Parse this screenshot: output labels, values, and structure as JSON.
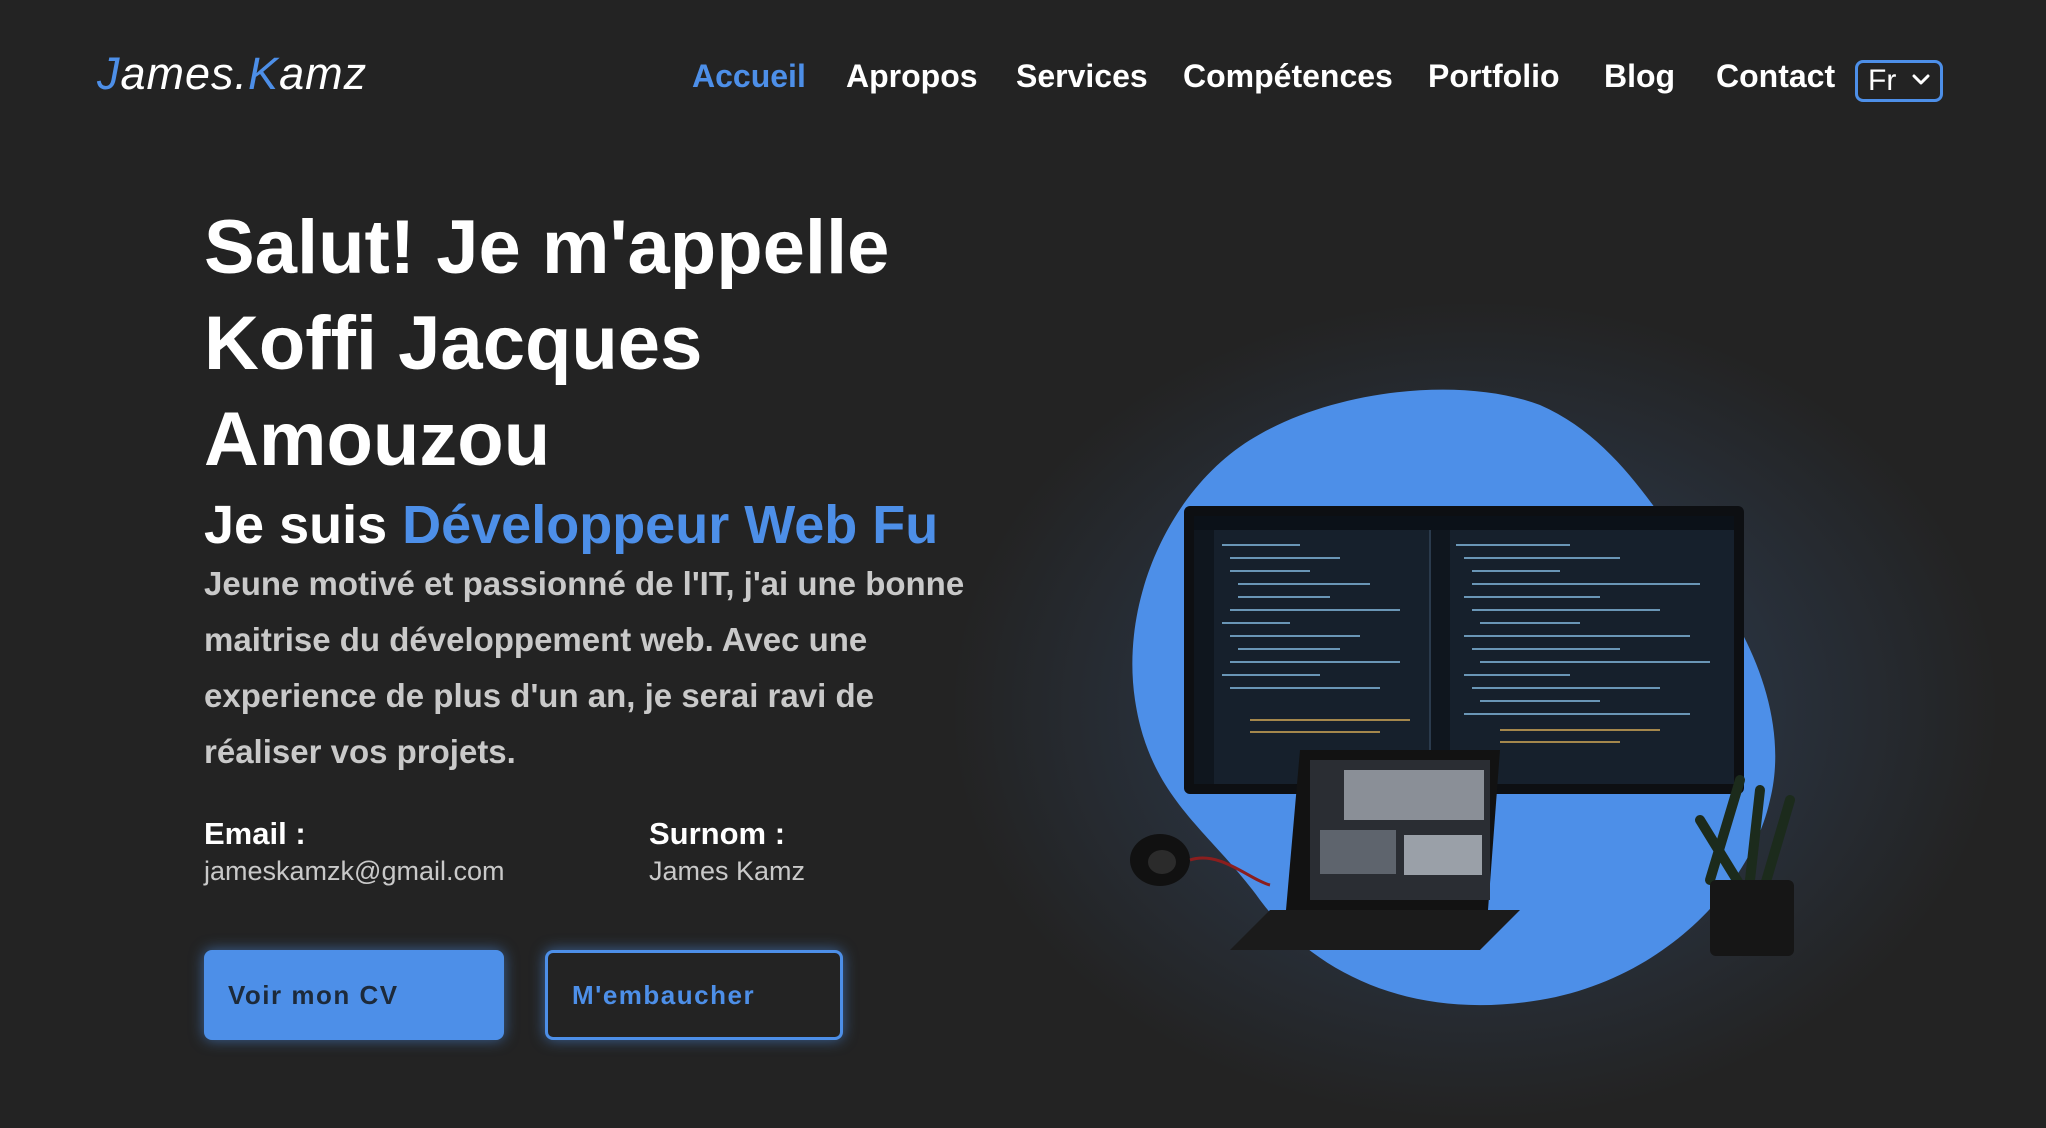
{
  "logo": {
    "part1": "J",
    "part2": "ames.",
    "part3": "K",
    "part4": "amz"
  },
  "nav": {
    "items": [
      {
        "label": "Accueil",
        "active": true
      },
      {
        "label": "Apropos"
      },
      {
        "label": "Services"
      },
      {
        "label": "Compétences"
      },
      {
        "label": "Portfolio"
      },
      {
        "label": "Blog"
      },
      {
        "label": "Contact"
      }
    ],
    "language": "Fr"
  },
  "hero": {
    "title_line1": "Salut! Je m'appelle",
    "title_line2": "Koffi Jacques",
    "title_line3": "Amouzou",
    "subtitle_prefix": "Je suis ",
    "subtitle_role": "Développeur Web Fu",
    "description": "Jeune motivé et passionné de l'IT, j'ai une bonne maitrise du développement web. Avec une experience de plus d'un an, je serai ravi de réaliser vos projets."
  },
  "info": {
    "email_label": "Email :",
    "email_value": "jameskamzk@gmail.com",
    "nickname_label": "Surnom :",
    "nickname_value": "James Kamz"
  },
  "buttons": {
    "cv": "Voir mon CV",
    "hire": "M'embaucher"
  },
  "colors": {
    "accent": "#4d8fe8",
    "background": "#232323",
    "muted_text": "#c9c9c9"
  }
}
